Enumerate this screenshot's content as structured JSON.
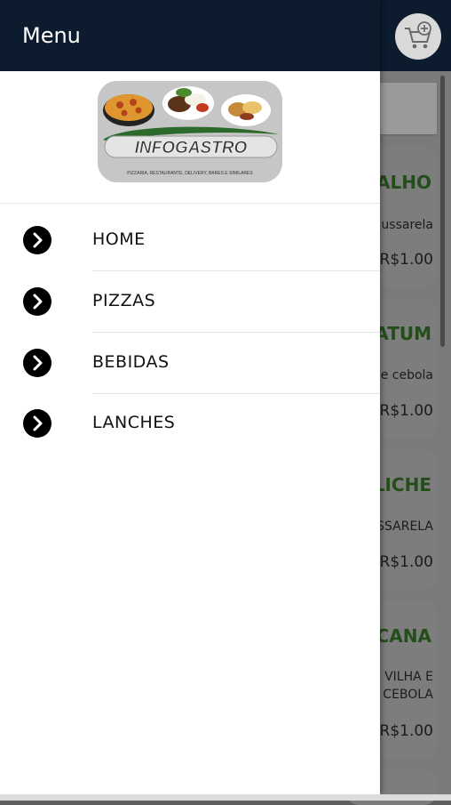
{
  "drawer": {
    "title": "Menu",
    "logo_text": "INFOGASTRO",
    "logo_subtitle": "PIZZARIA, RESTAURANTE, DELIVERY, BARES E SIMILARES",
    "items": [
      {
        "label": "HOME",
        "icon": "chevron-right-icon"
      },
      {
        "label": "PIZZAS",
        "icon": "chevron-right-icon"
      },
      {
        "label": "BEBIDAS",
        "icon": "chevron-right-icon"
      },
      {
        "label": "LANCHES",
        "icon": "chevron-right-icon"
      }
    ]
  },
  "background": {
    "cart_icon": "add-to-cart-icon",
    "products": [
      {
        "title": "ALHO",
        "desc": [
          "ussarela"
        ],
        "price": "R$1.00"
      },
      {
        "title": "ATUM",
        "desc": [
          "e cebola"
        ],
        "price": "R$1.00"
      },
      {
        "title": "LICHE",
        "desc": [
          "SSARELA"
        ],
        "price": "R$1.00"
      },
      {
        "title": "CANA",
        "desc": [
          "VILHA E",
          "CEBOLA"
        ],
        "price": "R$1.00"
      }
    ]
  },
  "colors": {
    "header": "#0c1b2d",
    "product_title": "#234e1a",
    "drawer_bg": "#ffffff"
  }
}
